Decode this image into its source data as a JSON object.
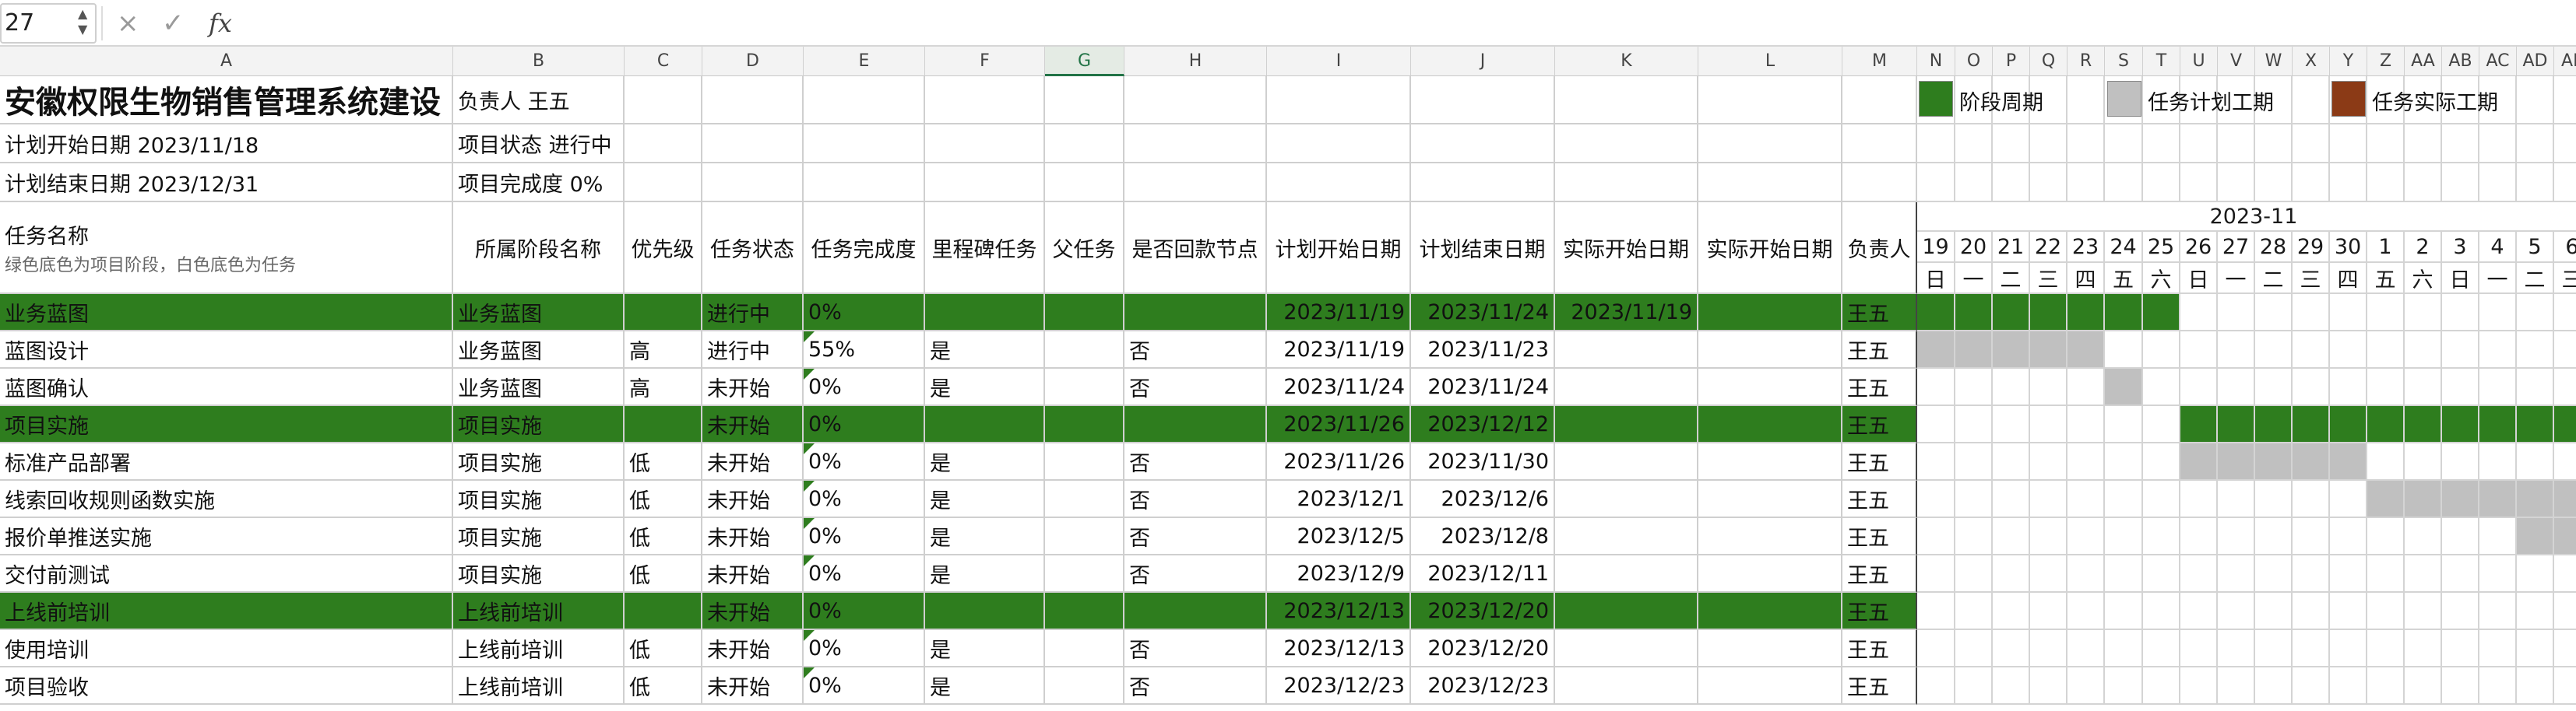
{
  "formula_bar": {
    "name_box": "27",
    "cancel_icon": "×",
    "confirm_icon": "✓",
    "fx_label": "fx",
    "formula": ""
  },
  "columns": [
    "A",
    "B",
    "C",
    "D",
    "E",
    "F",
    "G",
    "H",
    "I",
    "J",
    "K",
    "L",
    "M",
    "N",
    "O",
    "P",
    "Q",
    "R",
    "S",
    "T",
    "U",
    "V",
    "W",
    "X",
    "Y",
    "Z",
    "AA",
    "AB",
    "AC",
    "AD",
    "AE"
  ],
  "selected_column": "G",
  "project": {
    "title": "安徽权限生物销售管理系统建设",
    "owner": "负责人 王五",
    "plan_start": "计划开始日期 2023/11/18",
    "status": "项目状态 进行中",
    "plan_end": "计划结束日期 2023/12/31",
    "completion": "项目完成度 0%"
  },
  "legend": [
    {
      "label": "阶段周期",
      "color": "#2e7d1e"
    },
    {
      "label": "任务计划工期",
      "color": "#c0c0c0"
    },
    {
      "label": "任务实际工期",
      "color": "#8b3a16"
    }
  ],
  "headers": {
    "task": "任务名称",
    "task_note": "绿色底色为项目阶段，白色底色为任务",
    "phase": "所属阶段名称",
    "priority": "优先级",
    "status": "任务状态",
    "completion": "任务完成度",
    "milestone": "里程碑任务",
    "parent": "父任务",
    "payment": "是否回款节点",
    "plan_start": "计划开始日期",
    "plan_end": "计划结束日期",
    "actual_start": "实际开始日期",
    "actual_start2": "实际开始日期",
    "owner": "负责人"
  },
  "gantt": {
    "month": "2023-11",
    "days": [
      "19",
      "20",
      "21",
      "22",
      "23",
      "24",
      "25",
      "26",
      "27",
      "28",
      "29",
      "30",
      "1",
      "2",
      "3",
      "4",
      "5",
      "6"
    ],
    "weekdays": [
      "日",
      "一",
      "二",
      "三",
      "四",
      "五",
      "六",
      "日",
      "一",
      "二",
      "三",
      "四",
      "五",
      "六",
      "日",
      "一",
      "二",
      "三"
    ]
  },
  "rows": [
    {
      "name": "业务蓝图",
      "phase": "业务蓝图",
      "priority": "",
      "status": "进行中",
      "completion": "0%",
      "milestone": "",
      "parent": "",
      "payment": "",
      "plan_start": "2023/11/19",
      "plan_end": "2023/11/24",
      "actual_start": "2023/11/19",
      "actual_start2": "",
      "owner": "王五",
      "is_phase": true,
      "bar_start": 0,
      "bar_len": 7
    },
    {
      "name": "蓝图设计",
      "phase": "业务蓝图",
      "priority": "高",
      "status": "进行中",
      "completion": "55%",
      "milestone": "是",
      "parent": "",
      "payment": "否",
      "plan_start": "2023/11/19",
      "plan_end": "2023/11/23",
      "actual_start": "",
      "actual_start2": "",
      "owner": "王五",
      "is_phase": false,
      "bar_start": 0,
      "bar_len": 5
    },
    {
      "name": "蓝图确认",
      "phase": "业务蓝图",
      "priority": "高",
      "status": "未开始",
      "completion": "0%",
      "milestone": "是",
      "parent": "",
      "payment": "否",
      "plan_start": "2023/11/24",
      "plan_end": "2023/11/24",
      "actual_start": "",
      "actual_start2": "",
      "owner": "王五",
      "is_phase": false,
      "bar_start": 5,
      "bar_len": 1
    },
    {
      "name": "项目实施",
      "phase": "项目实施",
      "priority": "",
      "status": "未开始",
      "completion": "0%",
      "milestone": "",
      "parent": "",
      "payment": "",
      "plan_start": "2023/11/26",
      "plan_end": "2023/12/12",
      "actual_start": "",
      "actual_start2": "",
      "owner": "王五",
      "is_phase": true,
      "bar_start": 7,
      "bar_len": 11
    },
    {
      "name": "标准产品部署",
      "phase": "项目实施",
      "priority": "低",
      "status": "未开始",
      "completion": "0%",
      "milestone": "是",
      "parent": "",
      "payment": "否",
      "plan_start": "2023/11/26",
      "plan_end": "2023/11/30",
      "actual_start": "",
      "actual_start2": "",
      "owner": "王五",
      "is_phase": false,
      "bar_start": 7,
      "bar_len": 5
    },
    {
      "name": "线索回收规则函数实施",
      "phase": "项目实施",
      "priority": "低",
      "status": "未开始",
      "completion": "0%",
      "milestone": "是",
      "parent": "",
      "payment": "否",
      "plan_start": "2023/12/1",
      "plan_end": "2023/12/6",
      "actual_start": "",
      "actual_start2": "",
      "owner": "王五",
      "is_phase": false,
      "bar_start": 12,
      "bar_len": 6
    },
    {
      "name": "报价单推送实施",
      "phase": "项目实施",
      "priority": "低",
      "status": "未开始",
      "completion": "0%",
      "milestone": "是",
      "parent": "",
      "payment": "否",
      "plan_start": "2023/12/5",
      "plan_end": "2023/12/8",
      "actual_start": "",
      "actual_start2": "",
      "owner": "王五",
      "is_phase": false,
      "bar_start": 16,
      "bar_len": 2
    },
    {
      "name": "交付前测试",
      "phase": "项目实施",
      "priority": "低",
      "status": "未开始",
      "completion": "0%",
      "milestone": "是",
      "parent": "",
      "payment": "否",
      "plan_start": "2023/12/9",
      "plan_end": "2023/12/11",
      "actual_start": "",
      "actual_start2": "",
      "owner": "王五",
      "is_phase": false,
      "bar_start": 0,
      "bar_len": 0
    },
    {
      "name": "上线前培训",
      "phase": "上线前培训",
      "priority": "",
      "status": "未开始",
      "completion": "0%",
      "milestone": "",
      "parent": "",
      "payment": "",
      "plan_start": "2023/12/13",
      "plan_end": "2023/12/20",
      "actual_start": "",
      "actual_start2": "",
      "owner": "王五",
      "is_phase": true,
      "bar_start": 0,
      "bar_len": 0
    },
    {
      "name": "使用培训",
      "phase": "上线前培训",
      "priority": "低",
      "status": "未开始",
      "completion": "0%",
      "milestone": "是",
      "parent": "",
      "payment": "否",
      "plan_start": "2023/12/13",
      "plan_end": "2023/12/20",
      "actual_start": "",
      "actual_start2": "",
      "owner": "王五",
      "is_phase": false,
      "bar_start": 0,
      "bar_len": 0
    },
    {
      "name": "项目验收",
      "phase": "上线前培训",
      "priority": "低",
      "status": "未开始",
      "completion": "0%",
      "milestone": "是",
      "parent": "",
      "payment": "否",
      "plan_start": "2023/12/23",
      "plan_end": "2023/12/23",
      "actual_start": "",
      "actual_start2": "",
      "owner": "王五",
      "is_phase": false,
      "bar_start": 0,
      "bar_len": 0
    }
  ]
}
